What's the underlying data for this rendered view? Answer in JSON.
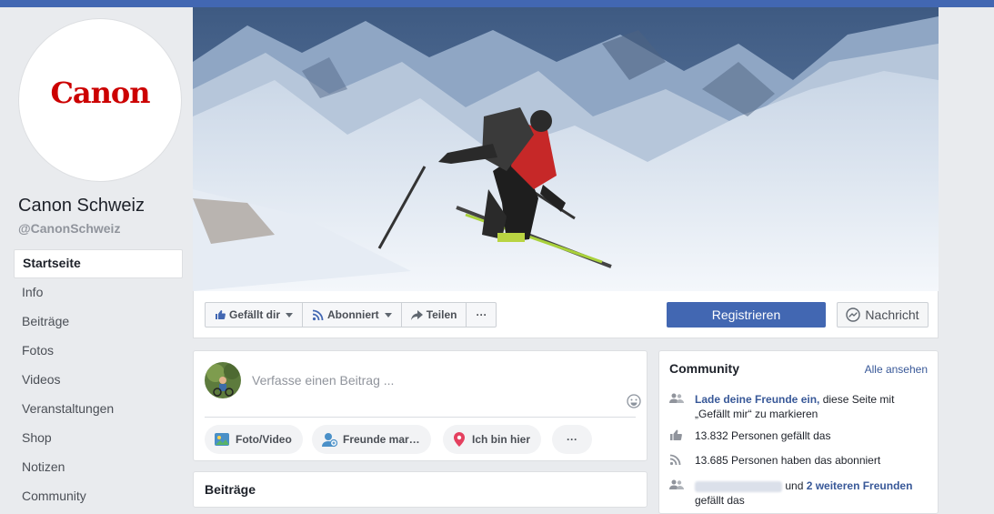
{
  "page": {
    "logo_text": "Canon",
    "name": "Canon Schweiz",
    "handle": "@CanonSchweiz"
  },
  "nav": {
    "items": [
      {
        "label": "Startseite"
      },
      {
        "label": "Info"
      },
      {
        "label": "Beiträge"
      },
      {
        "label": "Fotos"
      },
      {
        "label": "Videos"
      },
      {
        "label": "Veranstaltungen"
      },
      {
        "label": "Shop"
      },
      {
        "label": "Notizen"
      },
      {
        "label": "Community"
      }
    ]
  },
  "actions": {
    "like_label": "Gefällt dir",
    "follow_label": "Abonniert",
    "share_label": "Teilen",
    "more_label": "···",
    "register_label": "Registrieren",
    "message_label": "Nachricht"
  },
  "composer": {
    "placeholder": "Verfasse einen Beitrag ...",
    "photo_label": "Foto/Video",
    "tag_label": "Freunde mar…",
    "checkin_label": "Ich bin hier",
    "more_label": "···"
  },
  "posts": {
    "title": "Beiträge"
  },
  "community": {
    "title": "Community",
    "see_all": "Alle ansehen",
    "invite_link": "Lade deine Freunde ein,",
    "invite_rest": " diese Seite mit „Gefällt mir“ zu markieren",
    "likes_text": "13.832 Personen gefällt das",
    "follows_text": "13.685 Personen haben das abonniert",
    "friends_and": "und ",
    "friends_link": "2 weiteren Freunden",
    "friends_rest": "gefällt das"
  },
  "colors": {
    "brand_blue": "#4267b2",
    "link_blue": "#385898",
    "canon_red": "#cc0000"
  }
}
